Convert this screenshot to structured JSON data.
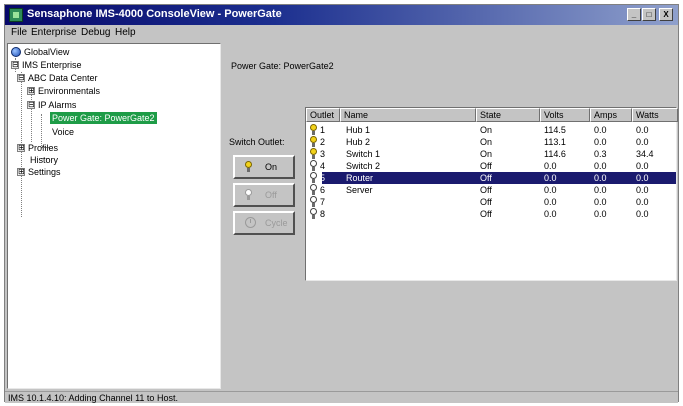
{
  "window": {
    "title": "Sensaphone IMS-4000 ConsoleView - PowerGate",
    "controls": {
      "minimize": "_",
      "maximize": "□",
      "close": "X"
    }
  },
  "menu": [
    "File",
    "Enterprise",
    "Debug",
    "Help"
  ],
  "tree": {
    "root": "GlobalView",
    "enterprise": "IMS Enterprise",
    "data_center": "ABC Data Center",
    "environmentals": "Environmentals",
    "ip_alarms": "IP Alarms",
    "power_gate": "Power Gate: PowerGate2",
    "voice": "Voice",
    "profiles": "Profiles",
    "history": "History",
    "settings": "Settings",
    "expand_symbol": "⊞",
    "collapse_symbol": "⊟"
  },
  "panel": {
    "power_gate_label": "Power Gate:",
    "power_gate_value": "PowerGate2",
    "switch_outlet_label": "Switch Outlet:",
    "on_button": "On",
    "off_button": "Off",
    "cycle_button": "Cycle"
  },
  "table": {
    "columns": [
      "Outlet",
      "Name",
      "State",
      "Volts",
      "Amps",
      "Watts"
    ],
    "rows": [
      {
        "outlet": "1",
        "name": "Hub 1",
        "state": "On",
        "volts": "114.5",
        "amps": "0.0",
        "watts": "0.0",
        "lit": true
      },
      {
        "outlet": "2",
        "name": "Hub 2",
        "state": "On",
        "volts": "113.1",
        "amps": "0.0",
        "watts": "0.0",
        "lit": true
      },
      {
        "outlet": "3",
        "name": "Switch 1",
        "state": "On",
        "volts": "114.6",
        "amps": "0.3",
        "watts": "34.4",
        "lit": true
      },
      {
        "outlet": "4",
        "name": "Switch 2",
        "state": "Off",
        "volts": "0.0",
        "amps": "0.0",
        "watts": "0.0",
        "lit": false
      },
      {
        "outlet": "5",
        "name": "Router",
        "state": "Off",
        "volts": "0.0",
        "amps": "0.0",
        "watts": "0.0",
        "lit": false,
        "selected": true
      },
      {
        "outlet": "6",
        "name": "Server",
        "state": "Off",
        "volts": "0.0",
        "amps": "0.0",
        "watts": "0.0",
        "lit": false
      },
      {
        "outlet": "7",
        "name": "",
        "state": "Off",
        "volts": "0.0",
        "amps": "0.0",
        "watts": "0.0",
        "lit": false
      },
      {
        "outlet": "8",
        "name": "",
        "state": "Off",
        "volts": "0.0",
        "amps": "0.0",
        "watts": "0.0",
        "lit": false
      }
    ]
  },
  "status": "IMS 10.1.4.10: Adding Channel 11 to Host.",
  "colors": {
    "title_bar": "#07086a",
    "selected_tree": "#1e9c47",
    "selected_row": "#1a1a6e",
    "bulb_on": "#f2d21a"
  }
}
